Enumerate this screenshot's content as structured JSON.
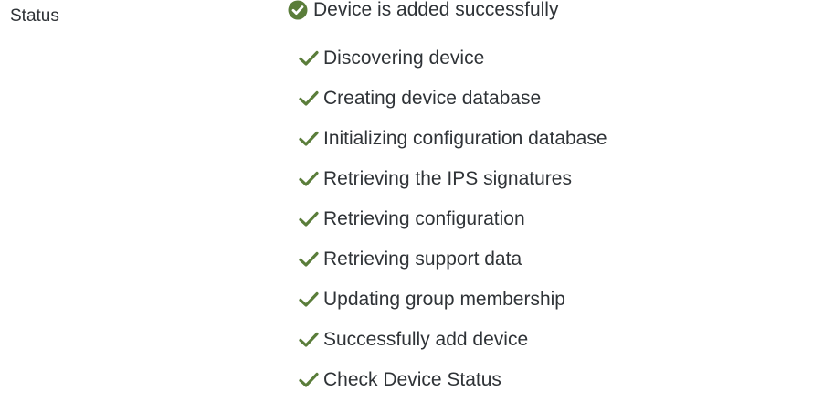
{
  "status": {
    "label": "Status",
    "summary": "Device is added successfully",
    "summary_icon": "check-circle-icon",
    "success_color": "#5a7d3a",
    "steps": [
      {
        "label": "Discovering device",
        "icon": "check-icon"
      },
      {
        "label": "Creating device database",
        "icon": "check-icon"
      },
      {
        "label": "Initializing configuration database",
        "icon": "check-icon"
      },
      {
        "label": "Retrieving the IPS signatures",
        "icon": "check-icon"
      },
      {
        "label": "Retrieving configuration",
        "icon": "check-icon"
      },
      {
        "label": "Retrieving support data",
        "icon": "check-icon"
      },
      {
        "label": "Updating group membership",
        "icon": "check-icon"
      },
      {
        "label": "Successfully add device",
        "icon": "check-icon"
      },
      {
        "label": "Check Device Status",
        "icon": "check-icon"
      }
    ]
  }
}
